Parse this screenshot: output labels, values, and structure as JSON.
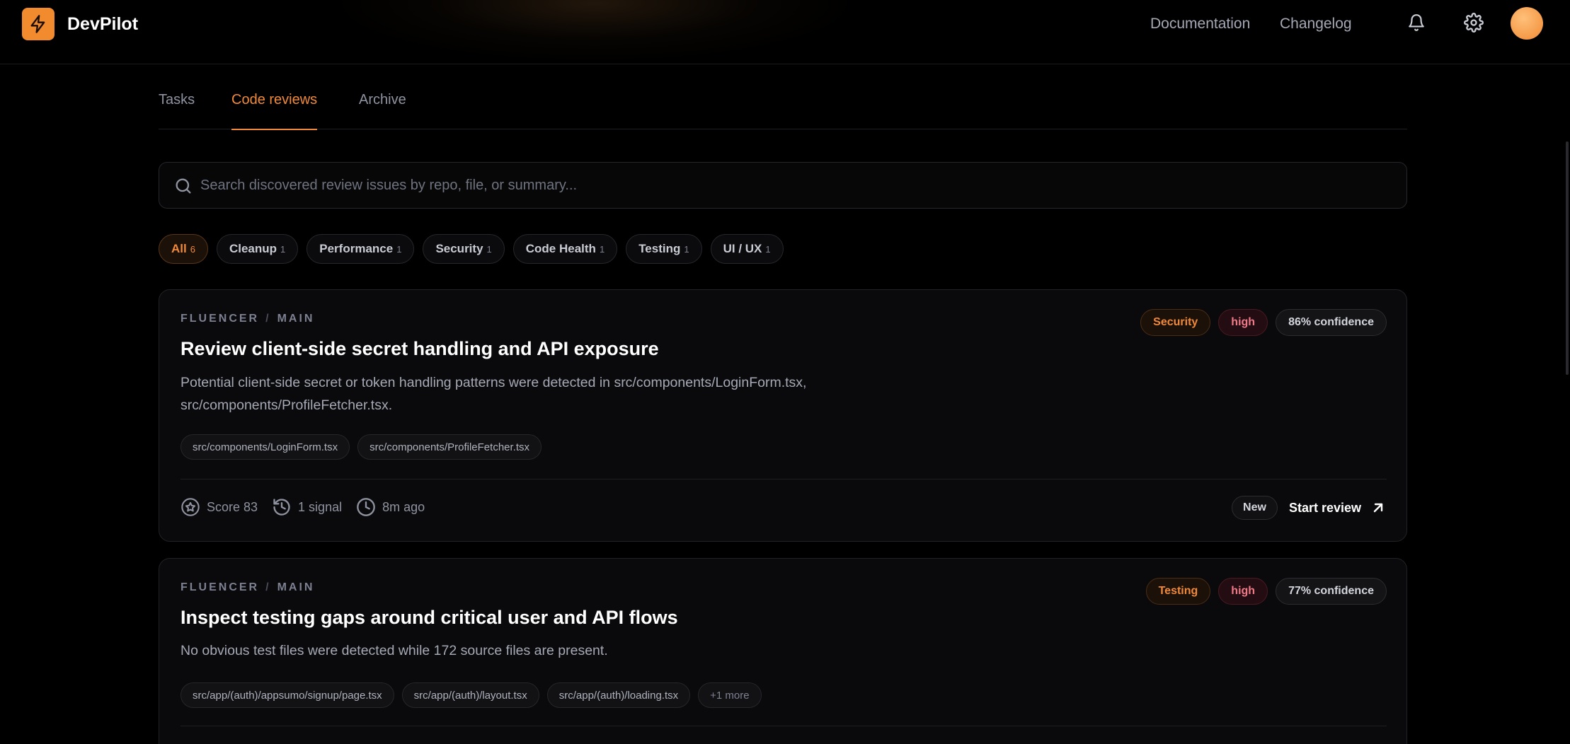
{
  "app": {
    "name": "DevPilot"
  },
  "header": {
    "nav": [
      {
        "label": "Documentation"
      },
      {
        "label": "Changelog"
      }
    ]
  },
  "tabs": [
    {
      "label": "Tasks",
      "active": false
    },
    {
      "label": "Code reviews",
      "active": true
    },
    {
      "label": "Archive",
      "active": false
    }
  ],
  "search": {
    "placeholder": "Search discovered review issues by repo, file, or summary...",
    "value": ""
  },
  "filters": [
    {
      "label": "All",
      "count": "6",
      "active": true
    },
    {
      "label": "Cleanup",
      "count": "1"
    },
    {
      "label": "Performance",
      "count": "1"
    },
    {
      "label": "Security",
      "count": "1"
    },
    {
      "label": "Code Health",
      "count": "1"
    },
    {
      "label": "Testing",
      "count": "1"
    },
    {
      "label": "UI / UX",
      "count": "1"
    }
  ],
  "reviews": [
    {
      "repo": "FLUENCER",
      "branch": "MAIN",
      "title": "Review client-side secret handling and API exposure",
      "summary": "Potential client-side secret or token handling patterns were detected in src/components/LoginForm.tsx, src/components/ProfileFetcher.tsx.",
      "files": [
        "src/components/LoginForm.tsx",
        "src/components/ProfileFetcher.tsx"
      ],
      "category": "Security",
      "severity": "high",
      "confidence": "86% confidence",
      "score": "Score 83",
      "signals": "1 signal",
      "age": "8m ago",
      "status": "New",
      "action": "Start review"
    },
    {
      "repo": "FLUENCER",
      "branch": "MAIN",
      "title": "Inspect testing gaps around critical user and API flows",
      "summary": "No obvious test files were detected while 172 source files are present.",
      "files": [
        "src/app/(auth)/appsumo/signup/page.tsx",
        "src/app/(auth)/layout.tsx",
        "src/app/(auth)/loading.tsx"
      ],
      "more": "+1 more",
      "category": "Testing",
      "severity": "high",
      "confidence": "77% confidence"
    }
  ],
  "colors": {
    "accent": "#f0893a",
    "logo": "#f28a2e",
    "severity_high": "#f07a88",
    "background": "#000000"
  },
  "icons": [
    "bolt-icon",
    "bell-icon",
    "gear-icon",
    "search-icon",
    "star-icon",
    "history-icon",
    "clock-icon",
    "arrow-up-right-icon"
  ]
}
